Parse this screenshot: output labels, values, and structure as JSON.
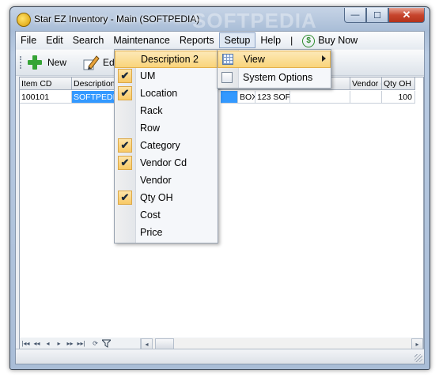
{
  "window": {
    "title": "Star EZ Inventory - Main (SOFTPEDIA)",
    "watermark": "SOFTPEDIA",
    "buttons": {
      "minimize": "—",
      "maximize": "☐",
      "close": "✕"
    }
  },
  "menubar": {
    "items": [
      "File",
      "Edit",
      "Search",
      "Maintenance",
      "Reports",
      "Setup",
      "Help"
    ],
    "separator": "|",
    "buy_now": "Buy Now",
    "buy_icon": "$"
  },
  "toolbar": {
    "new_label": "New",
    "edit_label_partial": "Ed"
  },
  "grid": {
    "headers": {
      "item_cd": "Item CD",
      "description": "Description",
      "vendor": "Vendor (",
      "qty_oh": "Qty OH"
    },
    "row": {
      "item_cd": "100101",
      "description": "SOFTPEDIA",
      "um": "BOX",
      "location": "123 SOF",
      "qty_oh": "100"
    }
  },
  "navigator": {
    "first": "|◂◂",
    "prev_page": "◂◂",
    "prev": "◂",
    "next": "▸",
    "next_page": "▸▸",
    "last": "▸▸|"
  },
  "view_menu": {
    "items": [
      {
        "label": "Description 2",
        "checked": false,
        "highlighted": true
      },
      {
        "label": "UM",
        "checked": true
      },
      {
        "label": "Location",
        "checked": true
      },
      {
        "label": "Rack",
        "checked": false
      },
      {
        "label": "Row",
        "checked": false
      },
      {
        "label": "Category",
        "checked": true
      },
      {
        "label": "Vendor Cd",
        "checked": true
      },
      {
        "label": "Vendor",
        "checked": false
      },
      {
        "label": "Qty OH",
        "checked": true
      },
      {
        "label": "Cost",
        "checked": false
      },
      {
        "label": "Price",
        "checked": false
      }
    ],
    "check_glyph": "✔"
  },
  "setup_menu": {
    "items": [
      {
        "label": "View",
        "icon": "grid-icon",
        "submenu": true,
        "highlighted": true
      },
      {
        "label": "System Options",
        "icon": "page-icon"
      }
    ]
  },
  "colors": {
    "selection": "#3399ff",
    "menu_highlight": "#f9d47a",
    "add_green": "#36a436"
  }
}
